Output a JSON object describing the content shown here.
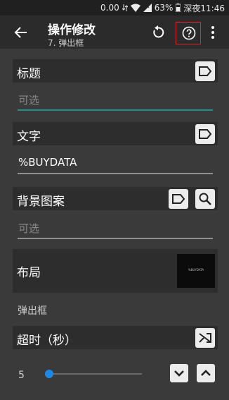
{
  "status": {
    "speed": "0.00",
    "speed_unit": "K/s",
    "battery": "63%",
    "time": "深夜11:46"
  },
  "appbar": {
    "title": "操作修改",
    "subtitle": "7. 弹出框"
  },
  "fields": {
    "title_label": "标题",
    "title_placeholder": "可选",
    "text_label": "文字",
    "text_value": "%BUYDATA",
    "background_label": "背景图案",
    "background_placeholder": "可选",
    "layout_label": "布局",
    "layout_preview_text": "%BUYDATA",
    "popup_section": "弹出框",
    "timeout_label": "超时（秒）",
    "timeout_value": "5"
  },
  "colors": {
    "accent": "#1e88e5",
    "teal_underline": "#1f8f8a",
    "highlight": "#e0242b"
  },
  "slider": {
    "fraction": 0.02
  }
}
